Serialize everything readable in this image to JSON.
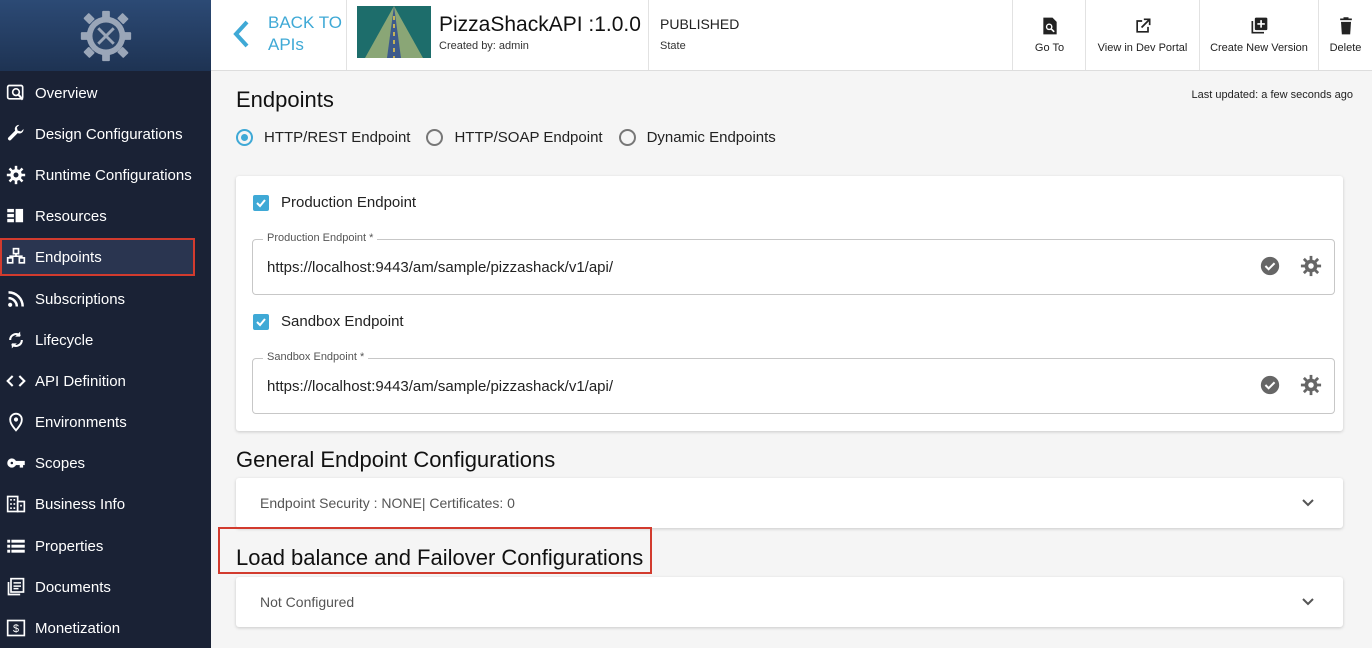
{
  "header": {
    "back_label_line1": "BACK TO",
    "back_label_line2": "APIs",
    "api_name": "PizzaShackAPI :1.0.0",
    "created_by": "Created by: admin",
    "state_value": "PUBLISHED",
    "state_label": "State",
    "actions": {
      "goto": "Go To",
      "devportal": "View in Dev Portal",
      "newversion": "Create New Version",
      "delete": "Delete"
    }
  },
  "sidebar": {
    "items": [
      {
        "label": "Overview",
        "icon": "overview-icon"
      },
      {
        "label": "Design Configurations",
        "icon": "wrench-icon"
      },
      {
        "label": "Runtime Configurations",
        "icon": "gear-icon"
      },
      {
        "label": "Resources",
        "icon": "resources-icon"
      },
      {
        "label": "Endpoints",
        "icon": "endpoints-icon",
        "active": true
      },
      {
        "label": "Subscriptions",
        "icon": "rss-icon"
      },
      {
        "label": "Lifecycle",
        "icon": "cycle-icon"
      },
      {
        "label": "API Definition",
        "icon": "code-icon"
      },
      {
        "label": "Environments",
        "icon": "location-icon"
      },
      {
        "label": "Scopes",
        "icon": "key-icon"
      },
      {
        "label": "Business Info",
        "icon": "building-icon"
      },
      {
        "label": "Properties",
        "icon": "list-icon"
      },
      {
        "label": "Documents",
        "icon": "documents-icon"
      },
      {
        "label": "Monetization",
        "icon": "dollar-icon"
      }
    ]
  },
  "main": {
    "title": "Endpoints",
    "last_updated": "Last updated: a few seconds ago",
    "endpoint_types": [
      {
        "label": "HTTP/REST Endpoint",
        "selected": true
      },
      {
        "label": "HTTP/SOAP Endpoint",
        "selected": false
      },
      {
        "label": "Dynamic Endpoints",
        "selected": false
      }
    ],
    "production": {
      "checkbox_label": "Production Endpoint",
      "field_label": "Production Endpoint *",
      "value": "https://localhost:9443/am/sample/pizzashack/v1/api/"
    },
    "sandbox": {
      "checkbox_label": "Sandbox Endpoint",
      "field_label": "Sandbox Endpoint *",
      "value": "https://localhost:9443/am/sample/pizzashack/v1/api/"
    },
    "general_title": "General Endpoint Configurations",
    "general_summary": "Endpoint Security : NONE| Certificates: 0",
    "lb_title": "Load balance and Failover Configurations",
    "lb_summary": "Not Configured"
  },
  "colors": {
    "accent": "#3fa9d6",
    "sidebar_bg": "#1a2235",
    "highlight": "#d23b2e"
  }
}
